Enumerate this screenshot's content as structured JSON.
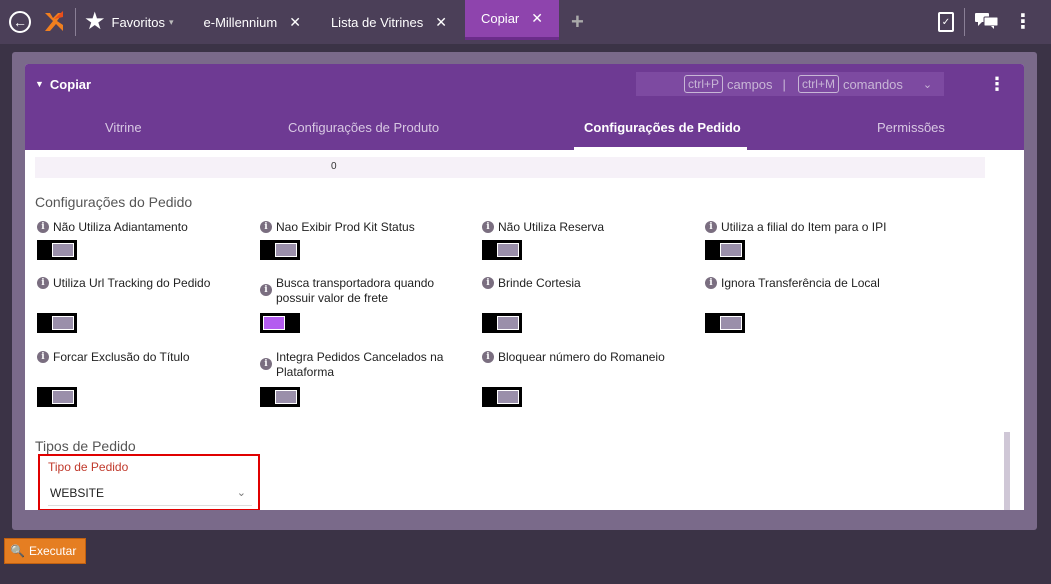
{
  "topbar": {
    "favorites_label": "Favoritos",
    "tabs": [
      {
        "label": "e-Millennium",
        "close": "✕"
      },
      {
        "label": "Lista de Vitrines",
        "close": "✕"
      },
      {
        "label": "Copiar",
        "close": "✕",
        "active": true
      }
    ],
    "add_tab": "+"
  },
  "card": {
    "title": "Copiar",
    "shortcut_fields_key": "ctrl+P",
    "shortcut_fields_label": "campos",
    "shortcut_commands_key": "ctrl+M",
    "shortcut_commands_label": "comandos",
    "separator": "|"
  },
  "tabs": [
    {
      "label": "Vitrine"
    },
    {
      "label": "Configurações de Produto"
    },
    {
      "label": "Configurações de Pedido",
      "active": true
    },
    {
      "label": "Permissões"
    }
  ],
  "strip_value": "0",
  "order_config": {
    "title": "Configurações do Pedido",
    "options": [
      {
        "label": "Não Utiliza Adiantamento",
        "on": false
      },
      {
        "label": "Nao Exibir Prod Kit Status",
        "on": false
      },
      {
        "label": "Não Utiliza Reserva",
        "on": false
      },
      {
        "label": "Utiliza a filial do Item para o IPI",
        "on": false
      },
      {
        "label": "Utiliza Url Tracking do Pedido",
        "on": false
      },
      {
        "label": "Busca transportadora quando possuir valor de frete",
        "on": true
      },
      {
        "label": "Brinde Cortesia",
        "on": false
      },
      {
        "label": "Ignora Transferência de Local",
        "on": false
      },
      {
        "label": "Forcar Exclusão do Título",
        "on": false
      },
      {
        "label": "Integra Pedidos Cancelados na Plataforma",
        "on": false
      },
      {
        "label": "Bloquear número do Romaneio",
        "on": false
      }
    ]
  },
  "order_types": {
    "title": "Tipos de Pedido",
    "field_label": "Tipo de Pedido",
    "selected_value": "WEBSITE"
  },
  "execute_button": "Executar",
  "colors": {
    "accent": "#6e3a93",
    "active_tab": "#8e44ad",
    "toggle_on": "#b45cf0",
    "execute": "#e57e22",
    "highlight": "#e00000"
  }
}
